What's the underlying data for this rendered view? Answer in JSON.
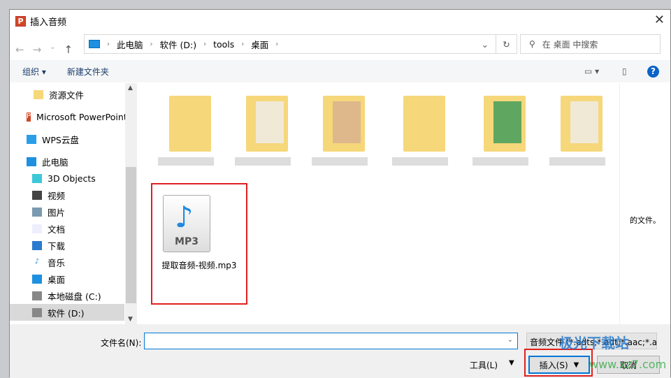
{
  "window": {
    "title": "插入音频",
    "app_icon": "powerpoint-icon"
  },
  "address": {
    "crumbs": [
      "此电脑",
      "软件 (D:)",
      "tools",
      "桌面"
    ]
  },
  "search": {
    "placeholder": "在 桌面 中搜索"
  },
  "toolbar": {
    "organize": "组织 ▾",
    "new_folder": "新建文件夹"
  },
  "sidebar": {
    "items": [
      {
        "label": "资源文件",
        "icon": "folder-icon"
      },
      {
        "label": "Microsoft PowerPoint",
        "icon": "powerpoint-icon"
      },
      {
        "label": "WPS云盘",
        "icon": "cloud-icon"
      },
      {
        "label": "此电脑",
        "icon": "computer-icon"
      },
      {
        "label": "3D Objects",
        "icon": "cube-icon"
      },
      {
        "label": "视频",
        "icon": "video-icon"
      },
      {
        "label": "图片",
        "icon": "picture-icon"
      },
      {
        "label": "文档",
        "icon": "document-icon"
      },
      {
        "label": "下载",
        "icon": "download-icon"
      },
      {
        "label": "音乐",
        "icon": "music-icon"
      },
      {
        "label": "桌面",
        "icon": "desktop-icon"
      },
      {
        "label": "本地磁盘 (C:)",
        "icon": "drive-icon"
      },
      {
        "label": "软件 (D:)",
        "icon": "drive-icon",
        "selected": true
      }
    ]
  },
  "files": {
    "selected": {
      "name": "提取音频-视频.mp3",
      "badge": "MP3"
    }
  },
  "preview": {
    "text": "的文件。"
  },
  "bottom": {
    "filename_label": "文件名(N):",
    "filename_value": "",
    "filetype": "音频文件 (*.adts;*.adt;*.aac;*.a",
    "tools": "工具(L)",
    "insert": "插入(S)",
    "cancel": "取消"
  },
  "watermark": {
    "text": "极光下载站",
    "url": "www.xz7.com"
  },
  "colors": {
    "highlight": "#e02020",
    "accent": "#0078d7"
  }
}
